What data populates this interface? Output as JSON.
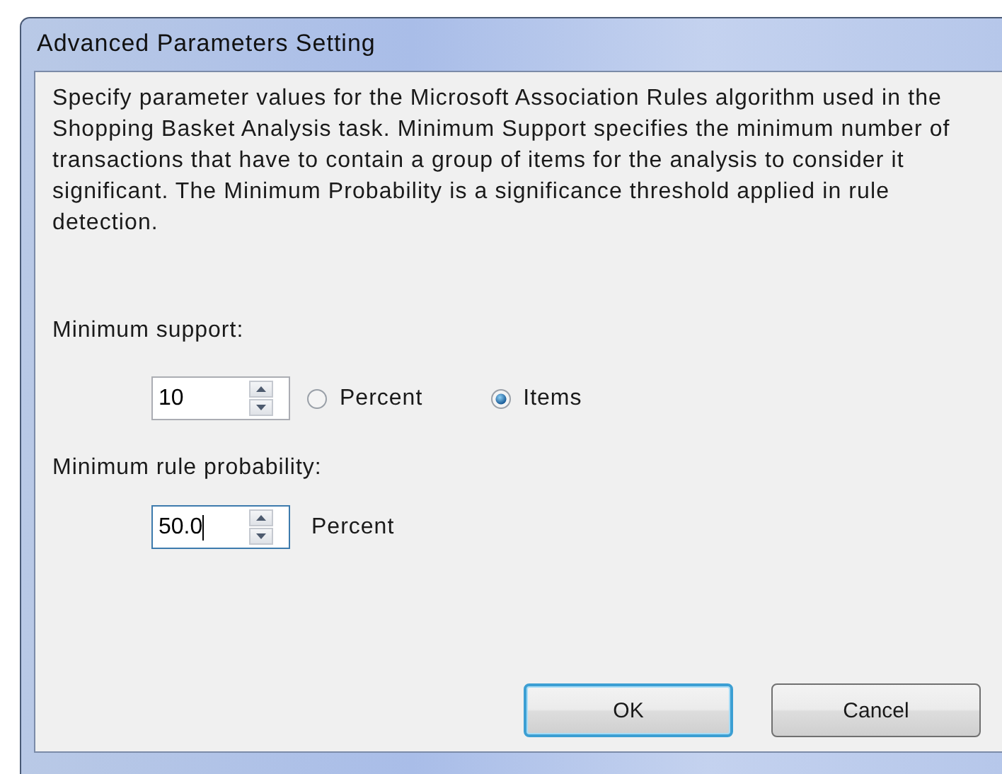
{
  "window": {
    "title": "Advanced Parameters Setting"
  },
  "description": "Specify parameter values for the Microsoft Association Rules algorithm used in the Shopping Basket Analysis task. Minimum Support specifies the minimum number of transactions that have to contain a group of items for the analysis to consider it significant. The Minimum Probability is a significance threshold applied in rule detection.",
  "fields": [
    {
      "label": "Minimum support:",
      "value": "10",
      "focused": false,
      "unit_options": [
        {
          "label": "Percent",
          "selected": false
        },
        {
          "label": "Items",
          "selected": true
        }
      ]
    },
    {
      "label": "Minimum rule probability:",
      "value": "50.0",
      "focused": true,
      "unit": "Percent"
    }
  ],
  "buttons": [
    {
      "label": "OK",
      "default": true
    },
    {
      "label": "Cancel",
      "default": false
    }
  ]
}
